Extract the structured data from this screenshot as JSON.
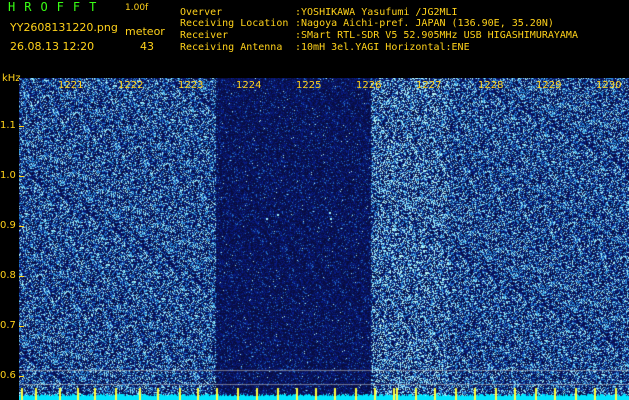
{
  "header": {
    "app_name": "HROFFT",
    "version": "1.00f",
    "filename": "YY2608131220.png",
    "datetime": "26.08.13 12:20",
    "meteor_label": "meteor",
    "meteor_count": "43"
  },
  "station_info": [
    {
      "label": "Overver",
      "value": ":YOSHIKAWA Yasufumi /JG2MLI"
    },
    {
      "label": "Receiving Location",
      "value": ":Nagoya Aichi-pref. JAPAN (136.90E, 35.20N)"
    },
    {
      "label": "Receiver",
      "value": ":SMart RTL-SDR V5 52.905MHz USB HIGASHIMURAYAMA"
    },
    {
      "label": "Receiving Antenna",
      "value": ":10mH 3el.YAGI Horizontal:ENE"
    }
  ],
  "spectrogram": {
    "y_unit": "kHz",
    "y_ticks": [
      "1.1",
      "1.0",
      "0.9",
      "0.8",
      "0.7",
      "0.6"
    ],
    "x_ticks": [
      "1221",
      "1222",
      "1223",
      "1224",
      "1225",
      "1226",
      "1226",
      "1227",
      "1228",
      "1229",
      "1230"
    ],
    "colors": {
      "background": "#000000",
      "noise_dark": "#0a0d5a",
      "noise_mid": "#1a2fb0",
      "noise_bright": "#5fe0ff",
      "baseline": "#00e5ff",
      "marker": "#ffff40",
      "label": "#ffd21a",
      "title": "#39ff14"
    }
  }
}
